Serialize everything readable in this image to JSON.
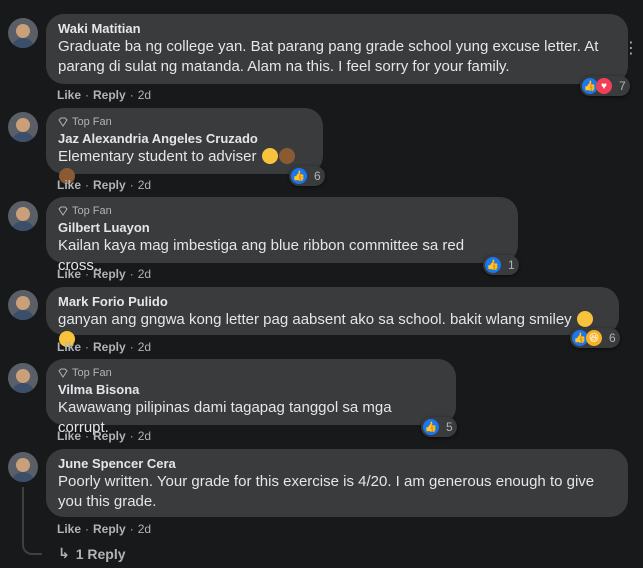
{
  "actions": {
    "like": "Like",
    "reply": "Reply",
    "sep": "·"
  },
  "top_fan_label": "Top Fan",
  "comments": [
    {
      "author": "Waki Matitian",
      "top_fan": false,
      "text": "Graduate ba ng college yan. Bat parang pang grade school yung excuse letter. At parang di sulat ng matanda. Alam na this. I feel sorry for your family.",
      "time": "2d",
      "reaction_count": "7",
      "reactions": [
        "like-icon",
        "love-icon"
      ]
    },
    {
      "author": "Jaz Alexandria Angeles Cruzado",
      "top_fan": true,
      "text": "Elementary student to adviser",
      "time": "2d",
      "reaction_count": "6",
      "reactions": [
        "like-icon"
      ]
    },
    {
      "author": "Gilbert Luayon",
      "top_fan": true,
      "text": "Kailan kaya mag imbestiga ang blue ribbon committee sa red cross..",
      "time": "2d",
      "reaction_count": "1",
      "reactions": [
        "like-icon"
      ]
    },
    {
      "author": "Mark Forio Pulido",
      "top_fan": false,
      "text": "ganyan ang gngwa kong letter pag aabsent ako sa school. bakit wlang smiley",
      "time": "2d",
      "reaction_count": "6",
      "reactions": [
        "like-icon",
        "haha-icon"
      ]
    },
    {
      "author": "Vilma Bisona",
      "top_fan": true,
      "text": "Kawawang pilipinas dami tagapag tanggol sa mga corrupt.",
      "time": "2d",
      "reaction_count": "5",
      "reactions": [
        "like-icon"
      ]
    },
    {
      "author": "June Spencer Cera",
      "top_fan": false,
      "text": "Poorly written. Your grade for this exercise is 4/20. I am generous enough to give you this grade.",
      "time": "2d",
      "reaction_count": "",
      "reactions": []
    }
  ],
  "replies_link": "1 Reply",
  "colors": {
    "background": "#18191a",
    "bubble": "#3a3b3c",
    "text": "#e4e6eb",
    "muted": "#b0b3b8",
    "like_blue": "#1877f2",
    "love_red": "#f33e58"
  }
}
